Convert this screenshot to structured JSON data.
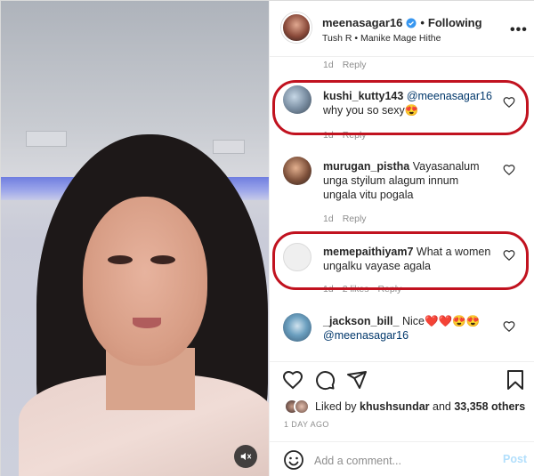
{
  "post": {
    "username": "meenasagar16",
    "follow_status": "Following",
    "sub_line": "Tush R • Manike Mage Hithe",
    "more_icon": "more-horizontal-icon"
  },
  "comments": [
    {
      "meta_time": "1d",
      "meta_reply": "Reply"
    },
    {
      "username": "kushi_kutty143",
      "mention": "@meenasagar16",
      "text": "why you so sexy",
      "emoji": "😍",
      "meta_time": "1d",
      "meta_reply": "Reply"
    },
    {
      "username": "murugan_pistha",
      "text": "Vayasanalum unga styilum alagum innum ungala vitu pogala",
      "meta_time": "1d",
      "meta_reply": "Reply"
    },
    {
      "username": "memepaithiyam7",
      "text": "What a women ungalku vayase agala",
      "meta_time": "1d",
      "meta_likes": "2 likes",
      "meta_reply": "Reply"
    },
    {
      "username": "_jackson_bill_",
      "text": "Nice",
      "emojis": "❤️❤️😍😍",
      "mention": "@meenasagar16"
    }
  ],
  "likes": {
    "liked_by_prefix": "Liked by ",
    "liked_by_user": "khushsundar",
    "and": " and ",
    "others": "33,358 others"
  },
  "timestamp": "1 DAY AGO",
  "add_comment": {
    "placeholder": "Add a comment...",
    "post_label": "Post"
  },
  "colors": {
    "highlight_circle": "#c1121f",
    "post_disabled": "#b2dffc",
    "mention": "#00376b"
  }
}
